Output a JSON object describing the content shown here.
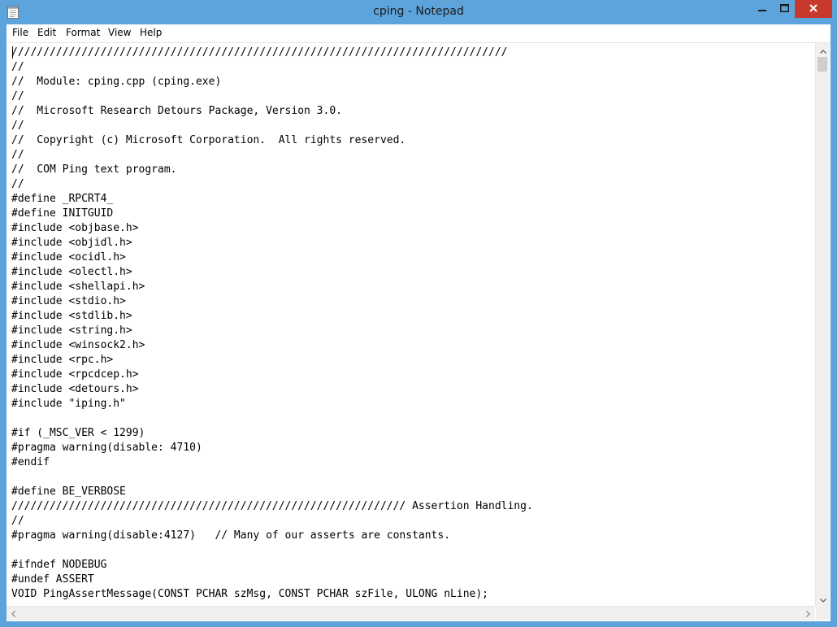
{
  "window": {
    "title": "cping - Notepad",
    "accent_color": "#5da4dc",
    "close_color": "#c7392b"
  },
  "menu": [
    {
      "label": "File"
    },
    {
      "label": "Edit"
    },
    {
      "label": "Format"
    },
    {
      "label": "View"
    },
    {
      "label": "Help"
    }
  ],
  "icons": {
    "app": "notepad-icon",
    "minimize": "minimize-icon",
    "maximize": "maximize-icon",
    "close": "close-icon",
    "scroll_up": "chevron-up-icon",
    "scroll_down": "chevron-down-icon",
    "scroll_left": "chevron-left-icon",
    "scroll_right": "chevron-right-icon"
  },
  "document": {
    "lines": [
      "//////////////////////////////////////////////////////////////////////////////",
      "//",
      "//  Module: cping.cpp (cping.exe)",
      "//",
      "//  Microsoft Research Detours Package, Version 3.0.",
      "//",
      "//  Copyright (c) Microsoft Corporation.  All rights reserved.",
      "//",
      "//  COM Ping text program.",
      "//",
      "#define _RPCRT4_",
      "#define INITGUID",
      "#include <objbase.h>",
      "#include <objidl.h>",
      "#include <ocidl.h>",
      "#include <olectl.h>",
      "#include <shellapi.h>",
      "#include <stdio.h>",
      "#include <stdlib.h>",
      "#include <string.h>",
      "#include <winsock2.h>",
      "#include <rpc.h>",
      "#include <rpcdcep.h>",
      "#include <detours.h>",
      "#include \"iping.h\"",
      "",
      "#if (_MSC_VER < 1299)",
      "#pragma warning(disable: 4710)",
      "#endif",
      "",
      "#define BE_VERBOSE",
      "////////////////////////////////////////////////////////////// Assertion Handling.",
      "//",
      "#pragma warning(disable:4127)   // Many of our asserts are constants.",
      "",
      "#ifndef NODEBUG",
      "#undef ASSERT",
      "VOID PingAssertMessage(CONST PCHAR szMsg, CONST PCHAR szFile, ULONG nLine);"
    ]
  }
}
